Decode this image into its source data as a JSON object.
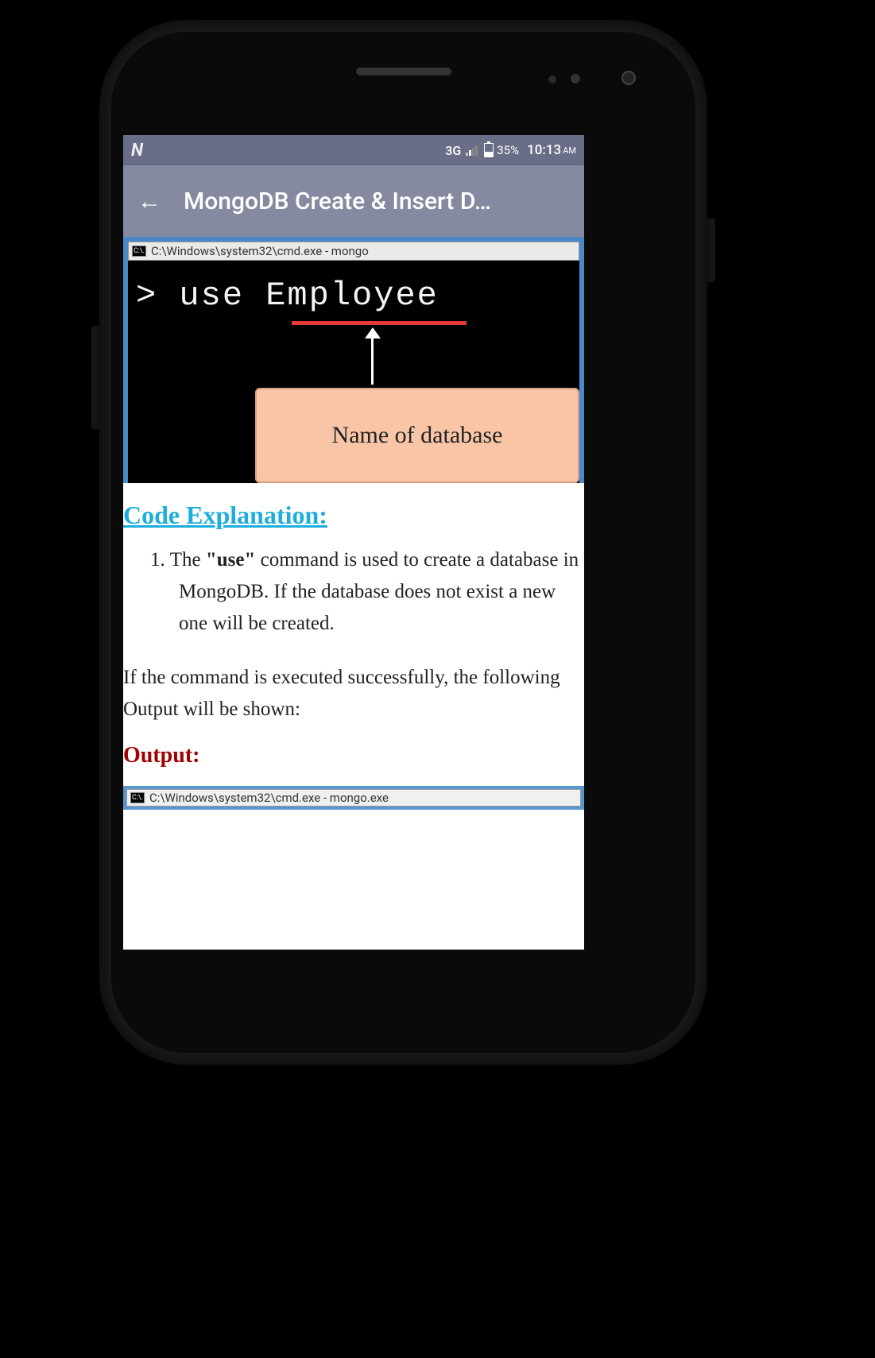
{
  "status_bar": {
    "logo": "N",
    "network": "3G",
    "battery": "35%",
    "time": "10:13",
    "ampm": "AM"
  },
  "app_bar": {
    "back_icon": "←",
    "title": "MongoDB Create & Insert D…"
  },
  "figure1": {
    "window_title": "C:\\Windows\\system32\\cmd.exe - mongo",
    "cmd_badge": "C:\\.",
    "prompt_line": "> use Employee",
    "annotation": "Name of database"
  },
  "section": {
    "heading": "Code Explanation:",
    "list_marker": "1.",
    "item1_pre": "The ",
    "item1_bold": "\"use\"",
    "item1_post": " command is used to create a database in MongoDB. If the database does not exist a new one will be created.",
    "para": "If the command is executed successfully, the following Output will be shown:",
    "output_label": "Output:"
  },
  "figure2": {
    "window_title": "C:\\Windows\\system32\\cmd.exe - mongo.exe",
    "cmd_badge": "C:\\."
  }
}
